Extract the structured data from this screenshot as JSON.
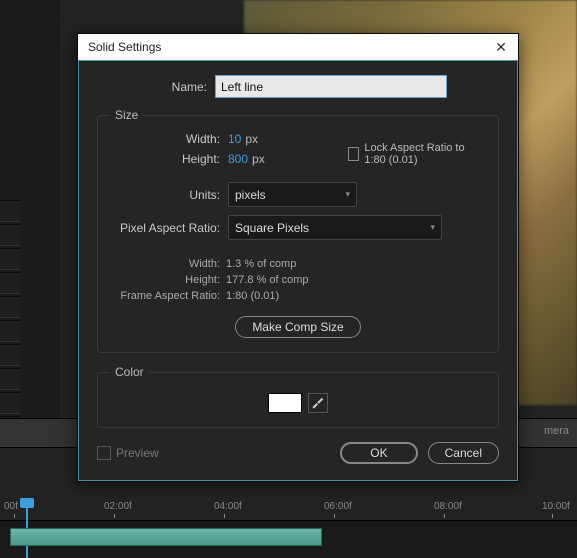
{
  "dialog": {
    "title": "Solid Settings",
    "name_label": "Name:",
    "name_value": "Left line",
    "size": {
      "legend": "Size",
      "width_label": "Width:",
      "width_value": "10",
      "width_unit": "px",
      "height_label": "Height:",
      "height_value": "800",
      "height_unit": "px",
      "lock_label": "Lock Aspect Ratio to 1:80 (0.01)",
      "units_label": "Units:",
      "units_value": "pixels",
      "par_label": "Pixel Aspect Ratio:",
      "par_value": "Square Pixels",
      "info_width_label": "Width:",
      "info_width_value": "1.3 % of comp",
      "info_height_label": "Height:",
      "info_height_value": "177.8 % of comp",
      "info_far_label": "Frame Aspect Ratio:",
      "info_far_value": "1:80 (0.01)",
      "make_comp_btn": "Make Comp Size"
    },
    "color": {
      "legend": "Color",
      "swatch_hex": "#ffffff"
    },
    "preview_label": "Preview",
    "ok_label": "OK",
    "cancel_label": "Cancel"
  },
  "bottom_strip": {
    "right_text": "mera"
  },
  "timeline": {
    "ticks": [
      "00f",
      "02:00f",
      "04:00f",
      "06:00f",
      "08:00f",
      "10:00f"
    ]
  }
}
